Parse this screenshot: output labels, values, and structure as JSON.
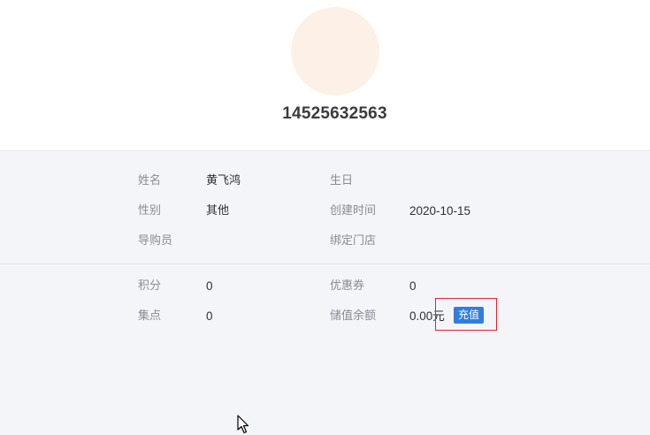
{
  "profile": {
    "phone": "14525632563",
    "avatar_color": "#fdf1e7"
  },
  "info": {
    "name_label": "姓名",
    "name_value": "黄飞鸿",
    "birthday_label": "生日",
    "birthday_value": "",
    "gender_label": "性别",
    "gender_value": "其他",
    "created_label": "创建时间",
    "created_value": "2020-10-15",
    "guide_label": "导购员",
    "guide_value": "",
    "store_label": "绑定门店",
    "store_value": ""
  },
  "assets": {
    "points_label": "积分",
    "points_value": "0",
    "coupons_label": "优惠券",
    "coupons_value": "0",
    "stamps_label": "集点",
    "stamps_value": "0",
    "balance_label": "储值余额",
    "balance_value": "0.00元",
    "recharge_label": "充值"
  },
  "colors": {
    "accent": "#2f7ee0",
    "highlight": "#e0262b",
    "panel_bg": "#f4f5f9"
  }
}
